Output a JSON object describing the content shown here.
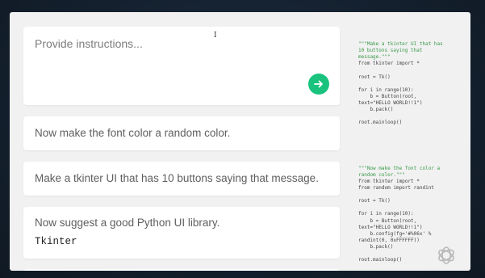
{
  "prompt": {
    "placeholder": "Provide instructions..."
  },
  "history": [
    {
      "text": "Now make the font color a random color."
    },
    {
      "text": "Make a tkinter UI that has 10 buttons saying that message."
    },
    {
      "text": "Now suggest a good Python UI library.",
      "response": "Tkinter"
    }
  ],
  "code_block_1": [
    {
      "text": "\"\"\"Make a tkinter UI that has",
      "color": "#3a9a4a"
    },
    {
      "text": "10 buttons saying that",
      "color": "#3a9a4a"
    },
    {
      "text": "message.\"\"\"",
      "color": "#3a9a4a"
    },
    {
      "text": "from tkinter import *",
      "color": "#444444"
    },
    {
      "text": "",
      "color": "#444444"
    },
    {
      "text": "root = Tk()",
      "color": "#444444"
    },
    {
      "text": "",
      "color": "#444444"
    },
    {
      "text": "for i in range(10):",
      "color": "#444444"
    },
    {
      "text": "    b = Button(root,",
      "color": "#444444"
    },
    {
      "text": "text=\"HELLO WORLD!!1\")",
      "color": "#444444"
    },
    {
      "text": "    b.pack()",
      "color": "#444444"
    },
    {
      "text": "",
      "color": "#444444"
    },
    {
      "text": "root.mainloop()",
      "color": "#444444"
    }
  ],
  "code_block_2": [
    {
      "text": "\"\"\"Now make the font color a",
      "color": "#3a9a4a"
    },
    {
      "text": "random color.\"\"\"",
      "color": "#3a9a4a"
    },
    {
      "text": "from tkinter import *",
      "color": "#444444"
    },
    {
      "text": "from random import randint",
      "color": "#444444"
    },
    {
      "text": "",
      "color": "#444444"
    },
    {
      "text": "root = Tk()",
      "color": "#444444"
    },
    {
      "text": "",
      "color": "#444444"
    },
    {
      "text": "for i in range(10):",
      "color": "#444444"
    },
    {
      "text": "    b = Button(root,",
      "color": "#444444"
    },
    {
      "text": "text=\"HELLO WORLD!!1\")",
      "color": "#444444"
    },
    {
      "text": "    b.config(fg='#%06x' %",
      "color": "#444444"
    },
    {
      "text": "randint(0, 0xFFFFFF))",
      "color": "#444444"
    },
    {
      "text": "    b.pack()",
      "color": "#444444"
    },
    {
      "text": "",
      "color": "#444444"
    },
    {
      "text": "root.mainloop()",
      "color": "#444444"
    }
  ],
  "icons": {
    "send": "arrow-right-icon",
    "logo": "openai-logo-icon"
  },
  "colors": {
    "accent": "#19c37d",
    "string": "#3a9a4a"
  }
}
